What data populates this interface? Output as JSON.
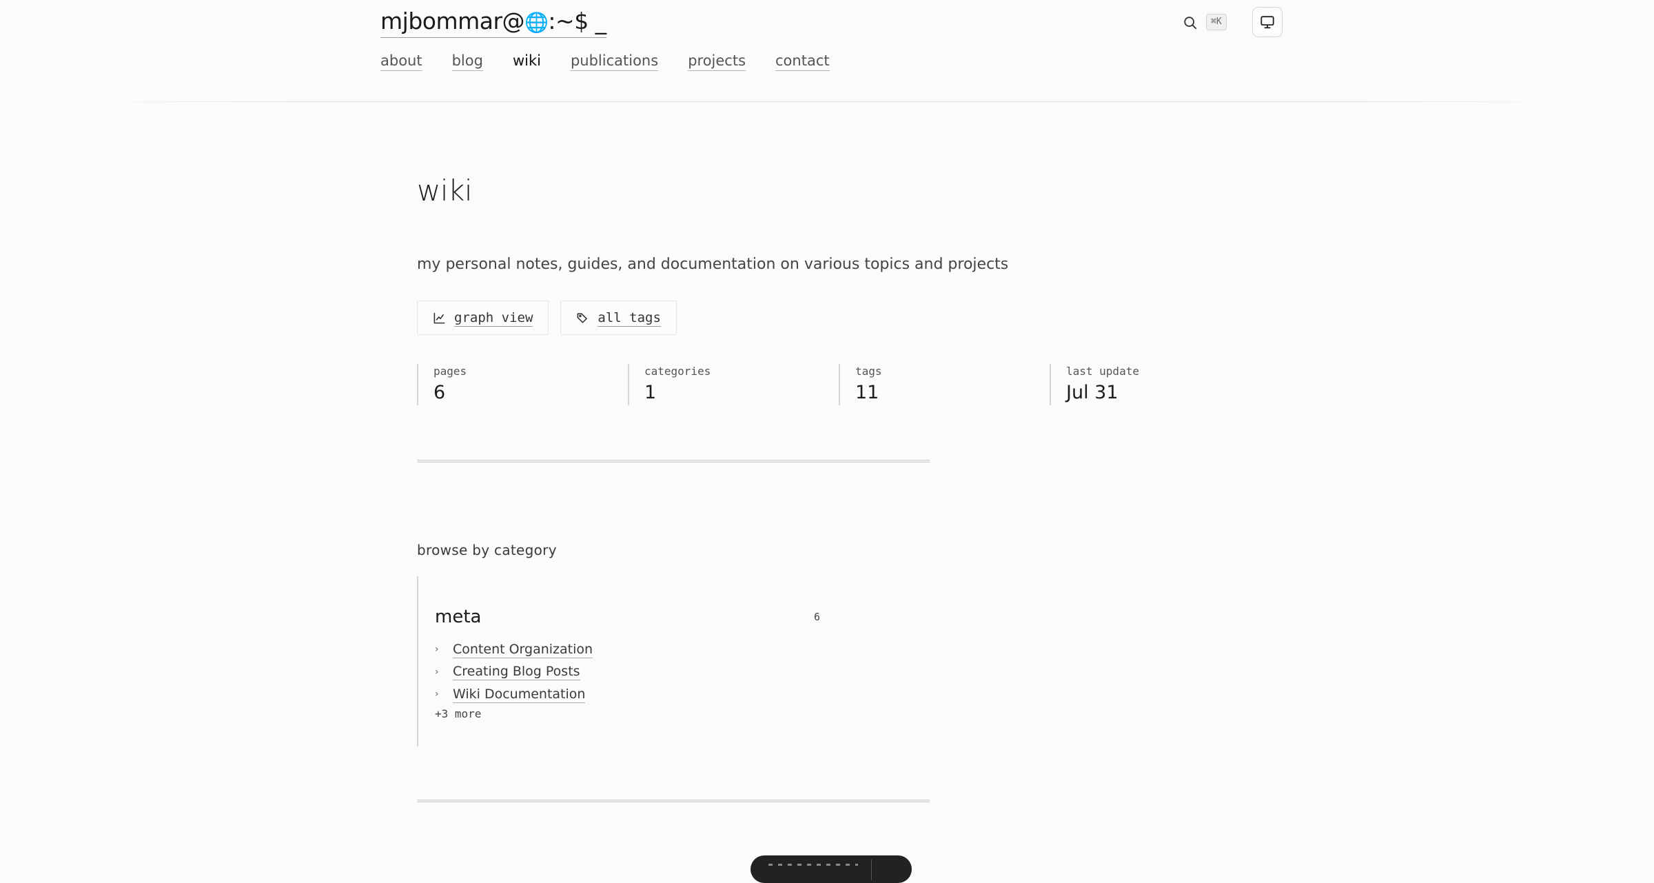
{
  "header": {
    "site_title_prefix": "mjbommar@",
    "site_title_globe": "🌐",
    "site_title_suffix": ":~$ _",
    "nav": [
      {
        "label": "about",
        "active": false
      },
      {
        "label": "blog",
        "active": false
      },
      {
        "label": "wiki",
        "active": true
      },
      {
        "label": "publications",
        "active": false
      },
      {
        "label": "projects",
        "active": false
      },
      {
        "label": "contact",
        "active": false
      }
    ],
    "search_icon": "search-icon",
    "search_shortcut": "⌘K",
    "theme_icon": "monitor-icon"
  },
  "main": {
    "title": "wiki",
    "description": "my personal notes, guides, and documentation on various topics and projects",
    "actions": [
      {
        "label": "graph view",
        "icon": "graph-icon"
      },
      {
        "label": "all tags",
        "icon": "tags-icon"
      }
    ],
    "stats": [
      {
        "key": "pages",
        "value": "6"
      },
      {
        "key": "categories",
        "value": "1"
      },
      {
        "key": "tags",
        "value": "11"
      },
      {
        "key": "last update",
        "value": "Jul 31"
      }
    ],
    "browse_heading": "browse by category",
    "categories": [
      {
        "name": "meta",
        "count": "6",
        "items": [
          "Content Organization",
          "Creating Blog Posts",
          "Wiki Documentation"
        ],
        "more": "+3 more"
      }
    ]
  },
  "colors": {
    "background": "#fbfbfb",
    "text": "#2b2b2b",
    "border": "#d4d4d4",
    "pill": "#222222"
  }
}
